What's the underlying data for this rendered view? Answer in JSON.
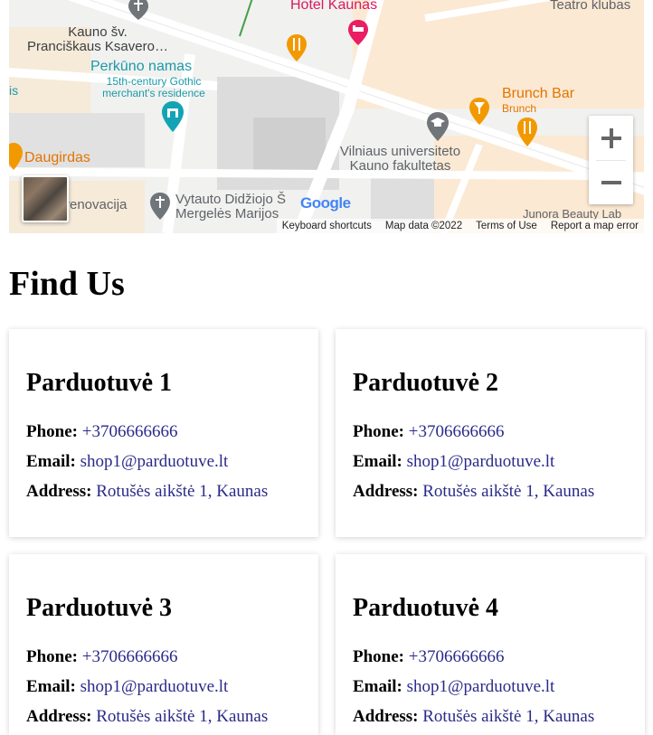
{
  "map": {
    "places": [
      {
        "name": "Kauno šv.\nPranciškaus Ksavero…",
        "color": "#3c4043"
      },
      {
        "name": "Perkūno namas",
        "color": "#1a9aa8"
      },
      {
        "name": "15th-century Gothic\nmerchant's residence",
        "color": "#1a9aa8"
      },
      {
        "name": "Hotel Kaunas",
        "color": "#d81b60"
      },
      {
        "name": "Teatro klubas",
        "color": "#5f6368"
      },
      {
        "name": "Brunch Bar",
        "color": "#e37400"
      },
      {
        "name": "Brunch",
        "color": "#e37400"
      },
      {
        "name": "Vilniaus universiteto\nKauno fakultetas",
        "color": "#5f6368"
      },
      {
        "name": "Daugirdas",
        "color": "#e37400"
      },
      {
        "name": "Vytauto Didžiojo Š\nMergelės Marijos",
        "color": "#5f6368"
      },
      {
        "name": "renovacija",
        "color": "#5f6368"
      },
      {
        "name": "Junora Beauty Lab",
        "color": "#5f6368"
      },
      {
        "name": "is",
        "color": "#1a9aa8"
      }
    ],
    "logo": "Google",
    "attribution": {
      "shortcuts": "Keyboard shortcuts",
      "data": "Map data ©2022",
      "terms": "Terms of Use",
      "report": "Report a map error"
    }
  },
  "page": {
    "title": "Find Us"
  },
  "labels": {
    "phone": "Phone:",
    "email": "Email:",
    "address": "Address:"
  },
  "shops": [
    {
      "name": "Parduotuvė 1",
      "phone": "+3706666666",
      "email": "shop1@parduotuve.lt",
      "address": "Rotušės aikštė 1, Kaunas"
    },
    {
      "name": "Parduotuvė 2",
      "phone": "+3706666666",
      "email": "shop1@parduotuve.lt",
      "address": "Rotušės aikštė 1, Kaunas"
    },
    {
      "name": "Parduotuvė 3",
      "phone": "+3706666666",
      "email": "shop1@parduotuve.lt",
      "address": "Rotušės aikštė 1, Kaunas"
    },
    {
      "name": "Parduotuvė 4",
      "phone": "+3706666666",
      "email": "shop1@parduotuve.lt",
      "address": "Rotušės aikštė 1, Kaunas"
    }
  ]
}
